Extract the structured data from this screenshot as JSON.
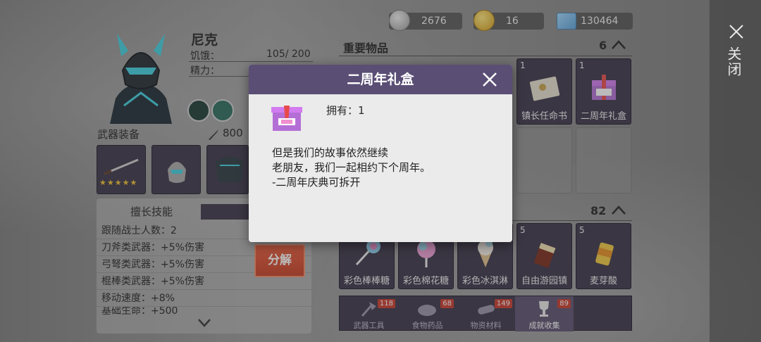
{
  "currencies": [
    {
      "icon": "silver-coin-icon",
      "value": "2676"
    },
    {
      "icon": "gold-coin-icon",
      "value": "16"
    },
    {
      "icon": "ticket-icon",
      "value": "130464"
    }
  ],
  "character": {
    "name": "尼克",
    "hunger_label": "饥饿：",
    "hunger_value": "105/ 200",
    "energy_label": "精力："
  },
  "weapons": {
    "title": "武器装备",
    "power": "800",
    "stars": 5
  },
  "skills": {
    "tab_active": "擅长技能",
    "tab_other": "",
    "rows": [
      "跟随战士人数：2",
      "刀斧类武器：+5%伤害",
      "弓弩类武器：+5%伤害",
      "棍棒类武器：+5%伤害",
      "移动速度：+8%",
      "基础生命：+500"
    ]
  },
  "split_button": "分解",
  "important": {
    "title": "重要物品",
    "count": "6",
    "items": [
      {
        "count": "1",
        "name": "镇长任命书",
        "icon": "scroll-icon"
      },
      {
        "count": "1",
        "name": "二周年礼盒",
        "icon": "gift-box-icon"
      }
    ]
  },
  "collectibles": {
    "count": "82",
    "items": [
      {
        "count": "",
        "name": "彩色棒棒糖",
        "icon": "lollipop-icon"
      },
      {
        "count": "",
        "name": "彩色棉花糖",
        "icon": "cotton-candy-icon"
      },
      {
        "count": "",
        "name": "彩色冰淇淋",
        "icon": "ice-cream-icon"
      },
      {
        "count": "5",
        "name": "自由游园镇",
        "icon": "drink-icon"
      },
      {
        "count": "5",
        "name": "麦芽酸",
        "icon": "malt-drink-icon"
      }
    ]
  },
  "bottom_tabs": [
    {
      "label": "武器工具",
      "badge": "118",
      "icon": "axe-icon"
    },
    {
      "label": "食物药品",
      "badge": "68",
      "icon": "bread-icon"
    },
    {
      "label": "物资材料",
      "badge": "149",
      "icon": "log-icon"
    },
    {
      "label": "成就收集",
      "badge": "89",
      "icon": "trophy-icon",
      "active": true
    }
  ],
  "close_label": "关闭",
  "dialog": {
    "title": "二周年礼盒",
    "owned": "拥有：1",
    "desc": [
      "但是我们的故事依然继续",
      "老朋友，我们一起相约下个周年。",
      "-二周年庆典可拆开"
    ]
  },
  "colors": {
    "dialog_header": "#5a4e75",
    "slot_bg": "#3a3348",
    "button": "#d9482c"
  }
}
